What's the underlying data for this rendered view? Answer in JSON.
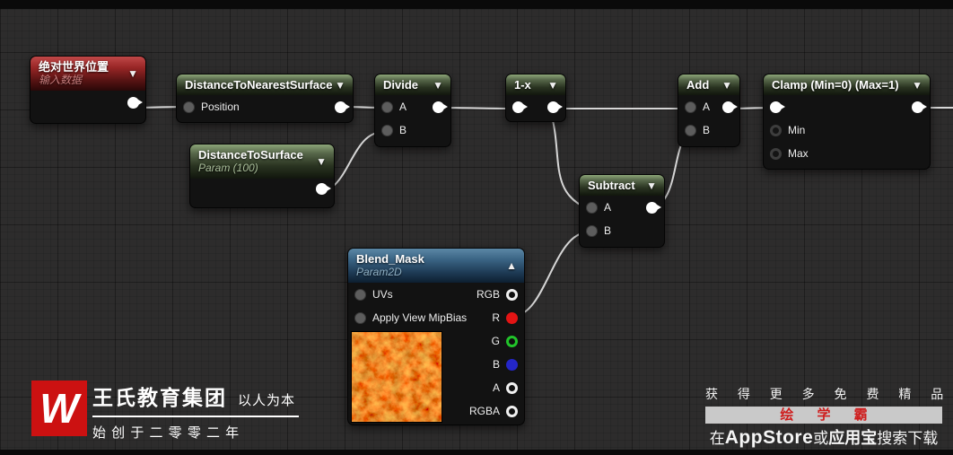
{
  "nodes": {
    "world_position": {
      "title": "绝对世界位置",
      "subtitle": "输入数据"
    },
    "distance_to_nearest_surface": {
      "title": "DistanceToNearestSurface",
      "pin_position": "Position"
    },
    "distance_to_surface": {
      "title": "DistanceToSurface",
      "subtitle": "Param (100)"
    },
    "divide": {
      "title": "Divide",
      "pin_a": "A",
      "pin_b": "B"
    },
    "one_minus_x": {
      "title": "1-x"
    },
    "subtract": {
      "title": "Subtract",
      "pin_a": "A",
      "pin_b": "B"
    },
    "add": {
      "title": "Add",
      "pin_a": "A",
      "pin_b": "B"
    },
    "clamp": {
      "title": "Clamp (Min=0) (Max=1)",
      "pin_min": "Min",
      "pin_max": "Max"
    },
    "blend_mask": {
      "title": "Blend_Mask",
      "subtitle": "Param2D",
      "pin_uvs": "UVs",
      "pin_mipbias": "Apply View MipBias",
      "pin_rgb": "RGB",
      "pin_r": "R",
      "pin_g": "G",
      "pin_b": "B",
      "pin_a": "A",
      "pin_rgba": "RGBA"
    }
  },
  "icons": {
    "collapse_down": "▼",
    "collapse_up": "▲"
  },
  "watermark_left": {
    "logo_letter": "W",
    "brand": "王氏教育集团",
    "slogan": "以人为本",
    "tagline": "始 创 于 二 零 零 二 年"
  },
  "watermark_right": {
    "line1": "获 得 更 多 免 费 精 品 教 程",
    "banner": "绘 学 霸",
    "line3_segments": [
      "在",
      "AppStore",
      "或",
      "应用宝",
      "搜索下载"
    ]
  },
  "colors": {
    "background": "#2d2c2c",
    "header_green": "#57674a",
    "header_red": "#992626",
    "header_blue": "#3a6484",
    "wire": "#d6d6d6",
    "pin_red": "#e31414",
    "pin_green": "#21c42a",
    "pin_blue": "#2426c8",
    "logo_red": "#cc1111",
    "banner_text_red": "#cf1d1d"
  }
}
